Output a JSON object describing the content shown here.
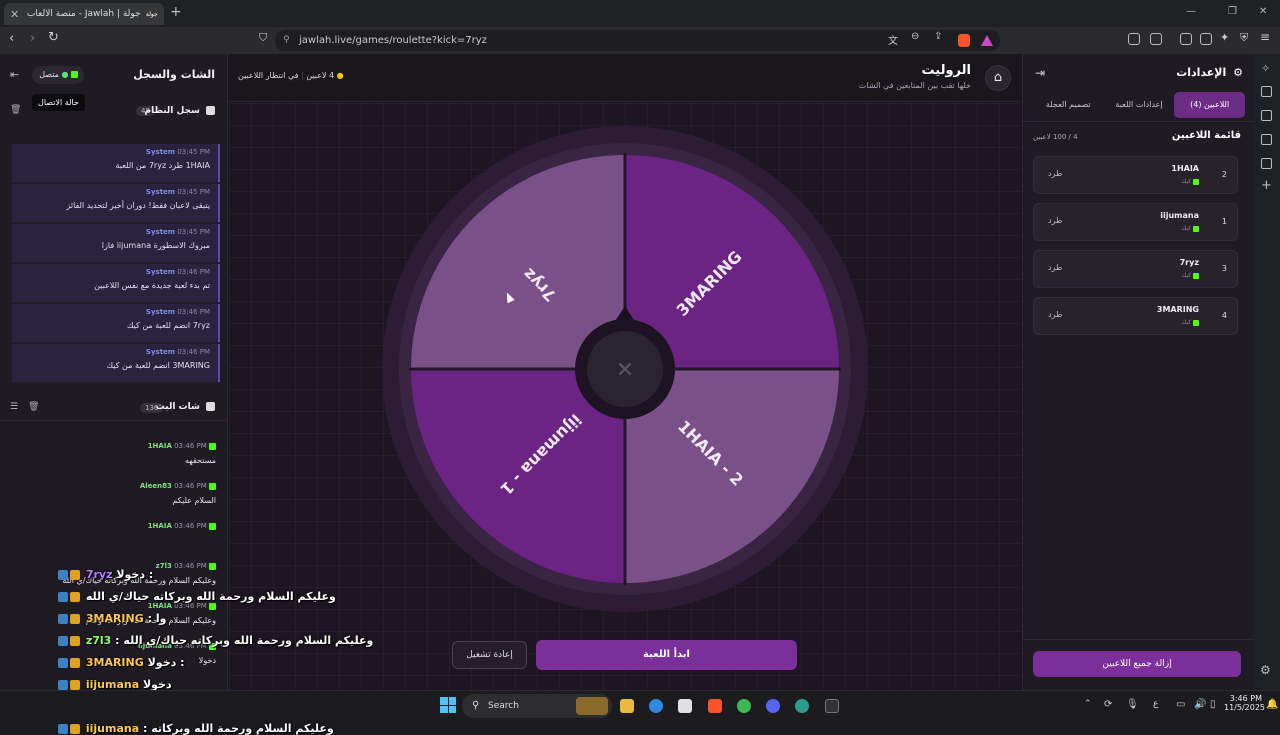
{
  "browser": {
    "tab_title": "جولة | Jawlah - منصة الألعاب التفا",
    "tab_badge": "جولة",
    "url": "jawlah.live/games/roulette?kick=7ryz"
  },
  "left_panel": {
    "title": "الشات والسجل",
    "status_label": "متصل",
    "tooltip": "حالة الاتصال",
    "system_log": {
      "title": "سجل النظام",
      "count": "48",
      "messages": [
        {
          "time": "03:45 PM",
          "author": "System",
          "text": "1HAIA طرد 7ryz من اللعبة"
        },
        {
          "time": "03:45 PM",
          "author": "System",
          "text": "يتبقى لاعبان فقط! دوران أخير لتحديد الفائز"
        },
        {
          "time": "03:45 PM",
          "author": "System",
          "text": "مبروك الاسطورة iijumana فازا"
        },
        {
          "time": "03:46 PM",
          "author": "System",
          "text": "تم بدء لعبة جديدة مع نفس اللاعبين"
        },
        {
          "time": "03:46 PM",
          "author": "System",
          "text": "7ryz انضم للعبة من كيك"
        },
        {
          "time": "03:46 PM",
          "author": "System",
          "text": "3MARING انضم للعبة من كيك"
        }
      ]
    },
    "live_chat": {
      "title": "شات البث",
      "count": "136",
      "messages": [
        {
          "user": "1HAIA",
          "time": "03:46 PM",
          "text": "مستحقهه"
        },
        {
          "user": "Aleen83",
          "time": "03:46 PM",
          "text": "السلام عليكم"
        },
        {
          "user": "1HAIA",
          "time": "03:46 PM",
          "text": ""
        },
        {
          "user": "z7l3",
          "time": "03:46 PM",
          "text": "وعليكم السلام ورحمة الله وبركاته حياك/ي الله"
        },
        {
          "user": "1HAIA",
          "time": "03:46 PM",
          "text": "وعليكم السلام ورحمة الله وبركاته ولكم"
        },
        {
          "user": "iijumana",
          "time": "03:46 PM",
          "text": "دخولا"
        }
      ]
    }
  },
  "header": {
    "title": "الروليت",
    "subtitle": "خلها تقب بين المتابعين في الشات",
    "players_count": "4 لاعبين",
    "status": "في انتظار اللاعبين"
  },
  "wheel": {
    "segments": [
      {
        "label": "3MARING",
        "color": "#6b2384"
      },
      {
        "label": "1HAIA - 2",
        "color": "#7a5088"
      },
      {
        "label": "iijumana - 1",
        "color": "#6b2384"
      },
      {
        "label": "7ryz",
        "color": "#7a5088"
      }
    ],
    "start_button": "ابدأ اللعبة",
    "reset_button": "إعادة تشغيل"
  },
  "settings": {
    "title": "الإعدادات",
    "tabs": [
      "اللاعبين (4)",
      "إعدادات اللعبة",
      "تصميم العجلة"
    ],
    "list_title": "قائمة اللاعبين",
    "list_count": "4 / 100 لاعبين",
    "players": [
      {
        "num": "2",
        "name": "1HAIA",
        "source": "كيك",
        "kick_label": "طرد"
      },
      {
        "num": "1",
        "name": "iijumana",
        "source": "كيك",
        "kick_label": "طرد"
      },
      {
        "num": "3",
        "name": "7ryz",
        "source": "كيك",
        "kick_label": "طرد"
      },
      {
        "num": "4",
        "name": "3MARING",
        "source": "كيك",
        "kick_label": "طرد"
      }
    ],
    "remove_all": "إزالة جميع اللاعبين"
  },
  "overlay_chat": [
    {
      "name": "7ryz",
      "text": "دخولا :",
      "color": "#b77cff"
    },
    {
      "name": "",
      "text": "وعليكم السلام ورحمة الله وبركاته حياك/ي الله",
      "color": "#ffffff"
    },
    {
      "name": "3MARING",
      "text": ": وا",
      "color": "#ffc94d"
    },
    {
      "name": "z7l3",
      "text": ": وعليكم السلام ورحمة الله وبركاته حياك/ي الله",
      "color": "#8fff6a"
    },
    {
      "name": "3MARING",
      "text": "دخولا :",
      "color": "#ffc94d"
    },
    {
      "name": "iijumana",
      "text": "دخولا",
      "color": "#ffc94d"
    },
    {
      "name": "1HAIA",
      "text": ": وعليكم السلام ورحمة الله وبركاته ولكم",
      "color": "#9ee7ff"
    },
    {
      "name": "iijumana",
      "text": ": وعليكم السلام ورحمة الله وبركاته",
      "color": "#ffc94d"
    }
  ],
  "taskbar": {
    "search": "Search",
    "time": "3:46 PM",
    "date": "11/5/2025",
    "lang": "ع"
  }
}
